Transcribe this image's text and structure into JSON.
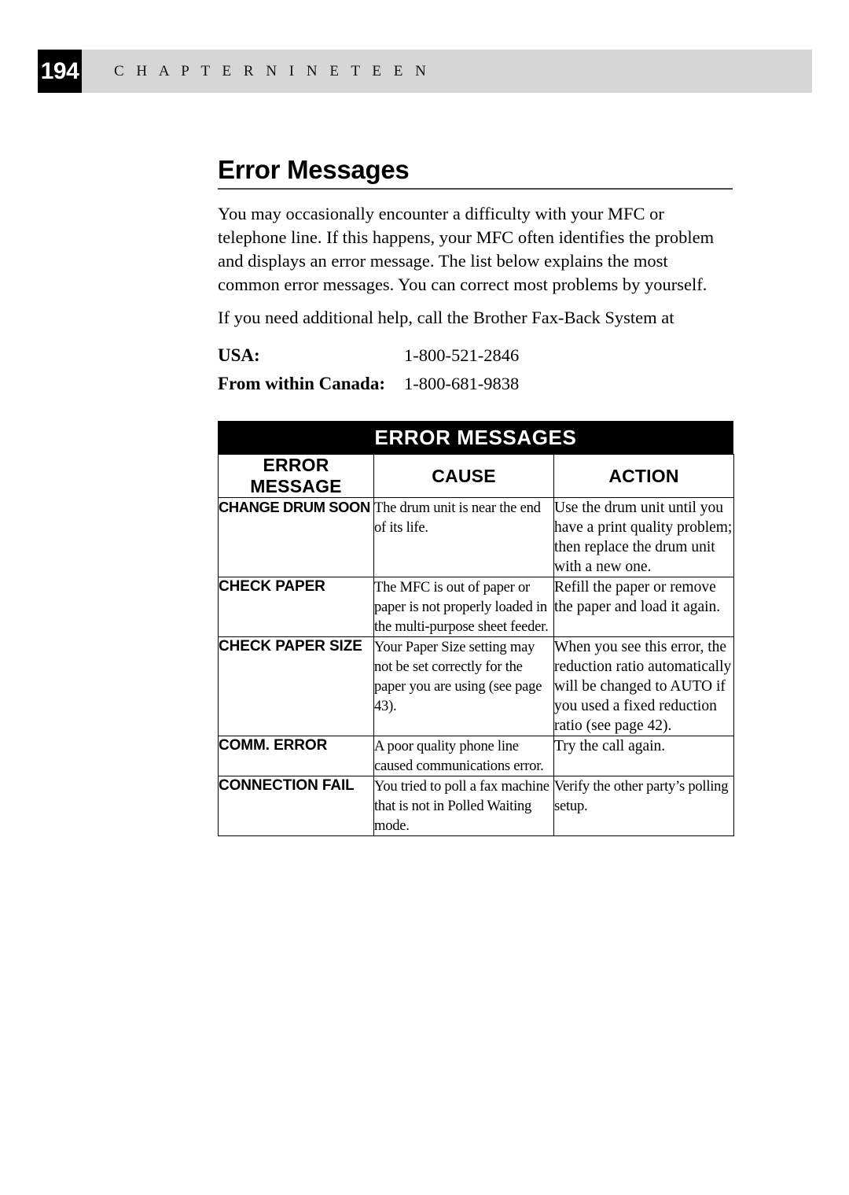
{
  "header": {
    "page_number": "194",
    "chapter_label": "C H A P T E R   N I N E T E E N",
    "band_color": "#d6d6d6",
    "box_color": "#000000"
  },
  "section": {
    "title": "Error Messages",
    "paragraph_1": "You may occasionally encounter a difficulty with your MFC or telephone line. If this happens, your MFC often identifies the problem and displays an error message. The list below explains the most common error messages. You can correct most problems by yourself.",
    "paragraph_2": "If you need additional help, call the Brother Fax-Back System at"
  },
  "faxback": {
    "rows": [
      {
        "label": "USA:",
        "number": "1-800-521-2846"
      },
      {
        "label": "From within Canada:",
        "number": "1-800-681-9838"
      }
    ]
  },
  "error_table": {
    "banner": "ERROR MESSAGES",
    "columns": [
      "ERROR MESSAGE",
      "CAUSE",
      "ACTION"
    ],
    "rows": [
      {
        "message": "CHANGE DRUM SOON",
        "cause": "The drum unit is near the end of its life.",
        "action": "Use the drum unit until you have a print quality problem; then replace the drum unit with a new one."
      },
      {
        "message": "CHECK PAPER",
        "cause": "The MFC is out of paper or paper is not properly loaded in the multi-purpose sheet feeder.",
        "action": "Refill the paper or remove the paper and load it again."
      },
      {
        "message": "CHECK PAPER SIZE",
        "cause": "Your Paper Size setting may not be set correctly for the paper you are using (see page 43).",
        "action": "When you see this error, the reduction ratio automatically will be changed to AUTO if you used a fixed reduction ratio (see page 42)."
      },
      {
        "message": "COMM. ERROR",
        "cause": "A poor quality phone line caused communications error.",
        "action": "Try the call again."
      },
      {
        "message": "CONNECTION FAIL",
        "cause": "You tried to poll a fax machine that is not in Polled Waiting mode.",
        "action": "Verify the other party’s polling setup."
      }
    ]
  }
}
